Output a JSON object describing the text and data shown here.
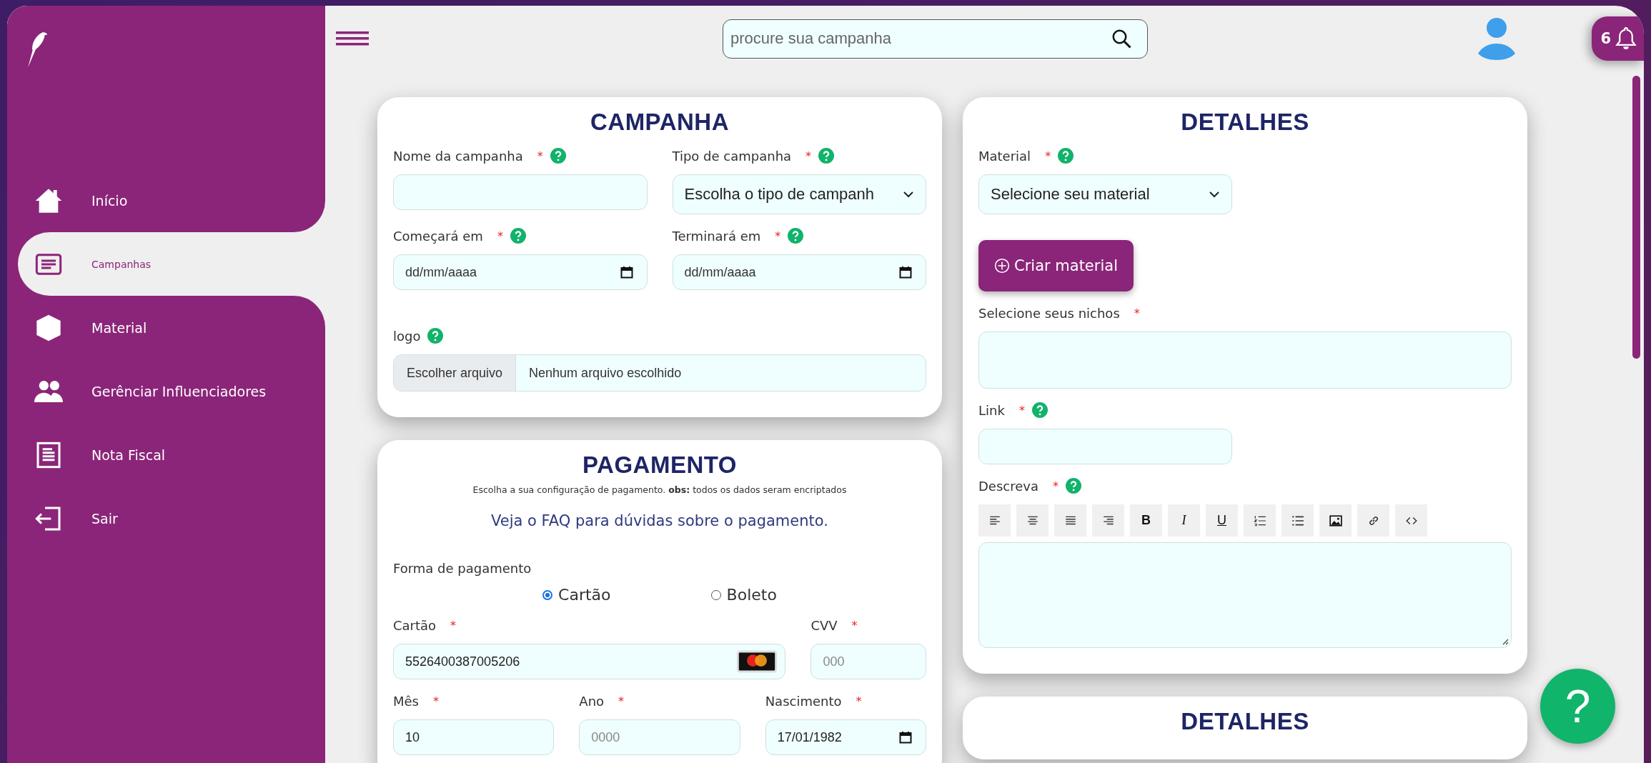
{
  "sidebar": {
    "items": [
      {
        "label": "Início",
        "selected": false
      },
      {
        "label": "Campanhas",
        "selected": true
      },
      {
        "label": "Material",
        "selected": false
      },
      {
        "label": "Gerênciar Influenciadores",
        "selected": false
      },
      {
        "label": "Nota Fiscal",
        "selected": false
      },
      {
        "label": "Sair",
        "selected": false
      }
    ]
  },
  "search": {
    "placeholder": "procure sua campanha"
  },
  "notifications": {
    "count": "6"
  },
  "required_mark": "*",
  "columns": [
    {
      "cards": [
        {
          "title": "CAMPANHA",
          "rows": [
            {
              "fields": [
                {
                  "kind": "text",
                  "label": "Nome da campanha",
                  "required": true,
                  "help": true
                },
                {
                  "kind": "select",
                  "label": "Tipo de campanha",
                  "required": true,
                  "help": true,
                  "value": "Escolha o tipo de campanh"
                }
              ]
            },
            {
              "fields": [
                {
                  "kind": "date",
                  "label": "Começará em",
                  "required": true,
                  "help": true,
                  "placeholder": "dd/mm/aaaa"
                },
                {
                  "kind": "date",
                  "label": "Terminará em",
                  "required": true,
                  "help": true,
                  "placeholder": "dd/mm/aaaa"
                }
              ]
            },
            {
              "fields": [
                {
                  "kind": "file",
                  "label": "logo",
                  "required": false,
                  "help": true,
                  "button": "Escolher arquivo",
                  "value": "Nenhum arquivo escolhido"
                }
              ]
            }
          ]
        },
        {
          "title": "PAGAMENTO",
          "rows": [
            {
              "fields": [
                {
                  "kind": "note",
                  "text": "Escolha a sua configuração de pagamento. **obs:** todos os dados seram encriptados"
                }
              ]
            },
            {
              "fields": [
                {
                  "kind": "faq",
                  "text": "Veja o FAQ para dúvidas sobre o pagamento."
                }
              ]
            },
            {
              "fields": [
                {
                  "kind": "radios",
                  "label": "Forma de pagamento",
                  "options": [
                    {
                      "label": "Cartão",
                      "selected": true
                    },
                    {
                      "label": "Boleto",
                      "selected": false
                    }
                  ]
                }
              ]
            },
            {
              "fields": [
                {
                  "kind": "card",
                  "label": "Cartão",
                  "required": true,
                  "help": false,
                  "value": "5526400387005206"
                },
                {
                  "kind": "text",
                  "label": "CVV",
                  "required": true,
                  "help": false,
                  "placeholder": "000"
                }
              ]
            },
            {
              "fields": [
                {
                  "kind": "text",
                  "label": "Mês",
                  "required": true,
                  "help": false,
                  "value": "10"
                },
                {
                  "kind": "text",
                  "label": "Ano",
                  "required": true,
                  "help": false,
                  "placeholder": "0000"
                },
                {
                  "kind": "date",
                  "label": "Nascimento",
                  "required": true,
                  "help": false,
                  "value": "17/01/1982"
                }
              ]
            }
          ]
        }
      ]
    },
    {
      "cards": [
        {
          "title": "DETALHES",
          "rows": [
            {
              "fields": [
                {
                  "kind": "select",
                  "label": "Material",
                  "required": true,
                  "help": true,
                  "value": "Selecione seu material"
                }
              ]
            },
            {
              "fields": [
                {
                  "kind": "button",
                  "label": "Criar material"
                }
              ]
            },
            {
              "fields": [
                {
                  "kind": "box",
                  "label": "Selecione seus nichos",
                  "required": true,
                  "help": false
                }
              ]
            },
            {
              "fields": [
                {
                  "kind": "text",
                  "label": "Link",
                  "required": true,
                  "help": true
                }
              ]
            },
            {
              "fields": [
                {
                  "kind": "editor",
                  "label": "Descreva",
                  "required": true,
                  "help": true,
                  "format_buttons": [
                    "B",
                    "I",
                    "U"
                  ]
                }
              ]
            }
          ]
        },
        {
          "title": "DETALHES"
        }
      ]
    }
  ],
  "help_button": {
    "label": "?"
  }
}
